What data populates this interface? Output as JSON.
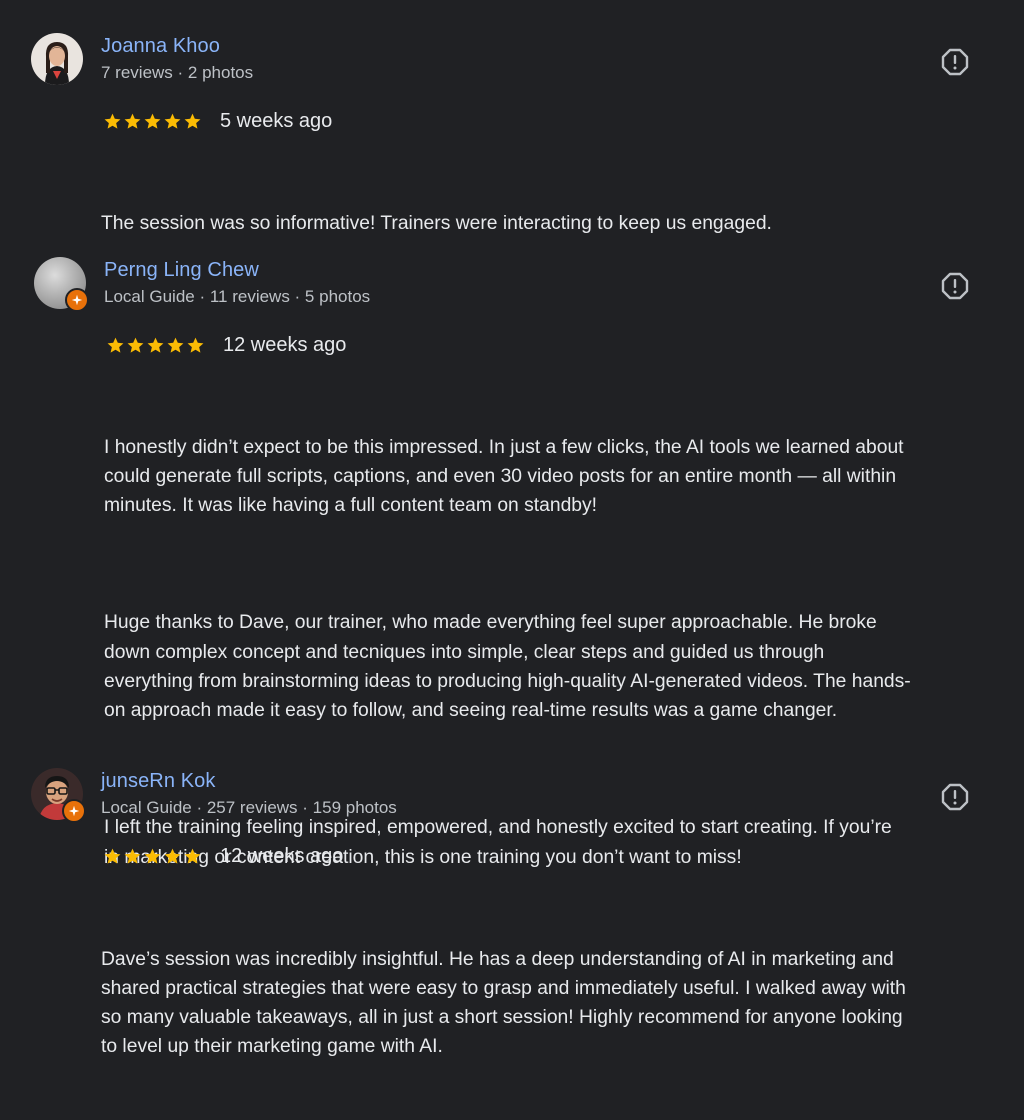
{
  "colors": {
    "background": "#202124",
    "name": "#8ab4f8",
    "star": "#fbbc04",
    "text": "#e8eaed",
    "meta": "#bdc1c6",
    "guide_badge": "#e8710a"
  },
  "reviews": [
    {
      "name": "Joanna Khoo",
      "meta": "7 reviews · 2 photos",
      "rating": 5,
      "age": "5 weeks ago",
      "paragraphs": [
        "The session was so informative! Trainers were interacting to keep us engaged."
      ],
      "avatar_icon": "user-photo",
      "flag_icon": "report-icon"
    },
    {
      "name": "Perng Ling Chew",
      "meta": "Local Guide · 11 reviews · 5 photos",
      "rating": 5,
      "age": "12 weeks ago",
      "paragraphs": [
        "I honestly didn’t expect to be this impressed. In just a few clicks, the AI tools we learned about\ncould generate full scripts, captions, and even 30 video posts for an entire month — all within\nminutes. It was like having a full content team on standby!",
        "Huge thanks to Dave, our trainer, who made everything feel super approachable. He broke\ndown complex concept and tecniques into simple, clear steps and guided us through\neverything from brainstorming ideas to producing high-quality AI-generated videos. The hands-\non approach made it easy to follow, and seeing real-time results was a game changer.",
        "I left the training feeling inspired, empowered, and honestly excited to start creating. If you’re\nin marketing or content creation, this is one training you don’t want to miss!"
      ],
      "avatar_icon": "user-photo",
      "badge_icon": "local-guide-icon",
      "flag_icon": "report-icon"
    },
    {
      "name": "junseRn Kok",
      "meta": "Local Guide · 257 reviews · 159 photos",
      "rating": 5,
      "age": "12 weeks ago",
      "paragraphs": [
        "Dave’s session was incredibly insightful. He has a deep understanding of AI in marketing and\nshared practical strategies that were easy to grasp and immediately useful. I walked away with\nso many valuable takeaways, all in just a short session! Highly recommend for anyone looking\nto level up their marketing game with AI."
      ],
      "avatar_icon": "user-photo",
      "badge_icon": "local-guide-icon",
      "flag_icon": "report-icon"
    }
  ]
}
